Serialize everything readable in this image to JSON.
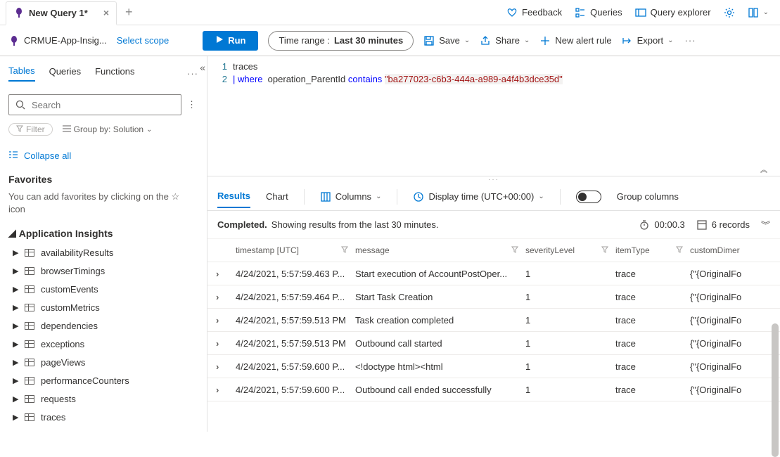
{
  "tabs": {
    "current": "New Query 1*"
  },
  "topLinks": {
    "feedback": "Feedback",
    "queries": "Queries",
    "explorer": "Query explorer"
  },
  "scope": {
    "resource": "CRMUE-App-Insig...",
    "select": "Select scope",
    "run": "Run",
    "timeLabel": "Time range :",
    "timeValue": "Last 30 minutes",
    "save": "Save",
    "share": "Share",
    "newAlert": "New alert rule",
    "export": "Export"
  },
  "sidebar": {
    "tabs": {
      "tables": "Tables",
      "queries": "Queries",
      "functions": "Functions"
    },
    "searchPlaceholder": "Search",
    "filter": "Filter",
    "groupBy": "Group by: Solution",
    "collapseAll": "Collapse all",
    "favTitle": "Favorites",
    "favHint": "You can add favorites by clicking on the ☆ icon",
    "treeTitle": "Application Insights",
    "tables": [
      "availabilityResults",
      "browserTimings",
      "customEvents",
      "customMetrics",
      "dependencies",
      "exceptions",
      "pageViews",
      "performanceCounters",
      "requests",
      "traces"
    ]
  },
  "editor": {
    "line1": "traces",
    "pipe": "|",
    "where": "where",
    "field": "operation_ParentId",
    "contains": "contains",
    "string": "\"ba277023-c6b3-444a-a989-a4f4b3dce35d\""
  },
  "results": {
    "tabs": {
      "results": "Results",
      "chart": "Chart"
    },
    "columnsBtn": "Columns",
    "displayTime": "Display time (UTC+00:00)",
    "groupCols": "Group columns",
    "statusBold": "Completed.",
    "statusRest": " Showing results from the last 30 minutes.",
    "duration": "00:00.3",
    "records": "6 records",
    "headers": {
      "ts": "timestamp [UTC]",
      "msg": "message",
      "sev": "severityLevel",
      "type": "itemType",
      "cust": "customDimer"
    },
    "rows": [
      {
        "ts": "4/24/2021, 5:57:59.463 P...",
        "msg": "Start execution of AccountPostOper...",
        "sev": "1",
        "type": "trace",
        "cust": "{\"{OriginalFo"
      },
      {
        "ts": "4/24/2021, 5:57:59.464 P...",
        "msg": "Start Task Creation",
        "sev": "1",
        "type": "trace",
        "cust": "{\"{OriginalFo"
      },
      {
        "ts": "4/24/2021, 5:57:59.513 PM",
        "msg": "Task creation completed",
        "sev": "1",
        "type": "trace",
        "cust": "{\"{OriginalFo"
      },
      {
        "ts": "4/24/2021, 5:57:59.513 PM",
        "msg": "Outbound call started",
        "sev": "1",
        "type": "trace",
        "cust": "{\"{OriginalFo"
      },
      {
        "ts": "4/24/2021, 5:57:59.600 P...",
        "msg": "<!doctype html><html",
        "sev": "1",
        "type": "trace",
        "cust": "{\"{OriginalFo"
      },
      {
        "ts": "4/24/2021, 5:57:59.600 P...",
        "msg": "Outbound call ended successfully",
        "sev": "1",
        "type": "trace",
        "cust": "{\"{OriginalFo"
      }
    ]
  }
}
